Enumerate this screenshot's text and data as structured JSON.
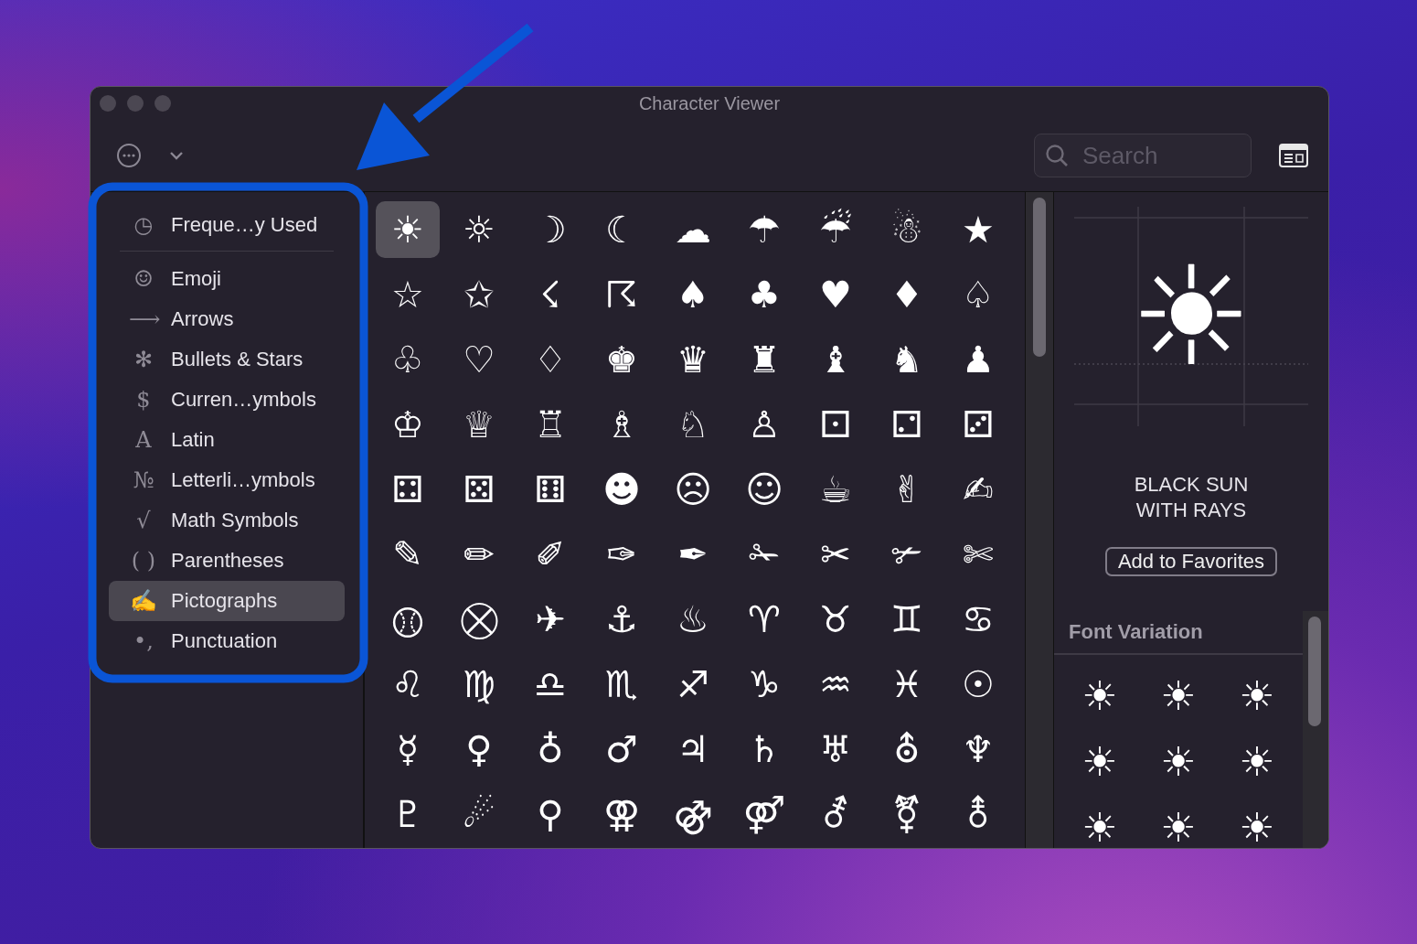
{
  "window": {
    "title": "Character Viewer"
  },
  "search": {
    "placeholder": "Search"
  },
  "sidebar": {
    "items": [
      {
        "icon": "◷",
        "label": "Freque…y Used",
        "selected": false
      },
      {
        "icon": "☺",
        "label": "Emoji",
        "selected": false
      },
      {
        "icon": "⟶",
        "label": "Arrows",
        "selected": false
      },
      {
        "icon": "✻",
        "label": "Bullets & Stars",
        "selected": false
      },
      {
        "icon": "$",
        "label": "Curren…ymbols",
        "selected": false
      },
      {
        "icon": "A",
        "label": "Latin",
        "selected": false
      },
      {
        "icon": "№",
        "label": "Letterli…ymbols",
        "selected": false
      },
      {
        "icon": "√",
        "label": "Math Symbols",
        "selected": false
      },
      {
        "icon": "( )",
        "label": "Parentheses",
        "selected": false
      },
      {
        "icon": "✍",
        "label": "Pictographs",
        "selected": true
      },
      {
        "icon": "•,",
        "label": "Punctuation",
        "selected": false
      }
    ]
  },
  "characters": [
    [
      {
        "char": "☀",
        "selected": true
      },
      {
        "char": "☼",
        "selected": false
      },
      {
        "char": "☽",
        "selected": false
      },
      {
        "char": "☾",
        "selected": false
      },
      {
        "char": "☁",
        "selected": false
      },
      {
        "char": "☂",
        "selected": false
      },
      {
        "char": "☔",
        "selected": false
      },
      {
        "char": "☃",
        "selected": false
      },
      {
        "char": "★",
        "selected": false
      }
    ],
    [
      {
        "char": "☆",
        "selected": false
      },
      {
        "char": "✩",
        "selected": false
      },
      {
        "char": "☇",
        "selected": false
      },
      {
        "char": "☈",
        "selected": false
      },
      {
        "char": "♠",
        "selected": false
      },
      {
        "char": "♣",
        "selected": false
      },
      {
        "char": "♥",
        "selected": false
      },
      {
        "char": "♦",
        "selected": false
      },
      {
        "char": "♤",
        "selected": false
      }
    ],
    [
      {
        "char": "♧",
        "selected": false
      },
      {
        "char": "♡",
        "selected": false
      },
      {
        "char": "♢",
        "selected": false
      },
      {
        "char": "♚",
        "selected": false
      },
      {
        "char": "♛",
        "selected": false
      },
      {
        "char": "♜",
        "selected": false
      },
      {
        "char": "♝",
        "selected": false
      },
      {
        "char": "♞",
        "selected": false
      },
      {
        "char": "♟",
        "selected": false
      }
    ],
    [
      {
        "char": "♔",
        "selected": false
      },
      {
        "char": "♕",
        "selected": false
      },
      {
        "char": "♖",
        "selected": false
      },
      {
        "char": "♗",
        "selected": false
      },
      {
        "char": "♘",
        "selected": false
      },
      {
        "char": "♙",
        "selected": false
      },
      {
        "char": "⚀",
        "selected": false
      },
      {
        "char": "⚁",
        "selected": false
      },
      {
        "char": "⚂",
        "selected": false
      }
    ],
    [
      {
        "char": "⚃",
        "selected": false
      },
      {
        "char": "⚄",
        "selected": false
      },
      {
        "char": "⚅",
        "selected": false
      },
      {
        "char": "☻",
        "selected": false
      },
      {
        "char": "☹",
        "selected": false
      },
      {
        "char": "☺",
        "selected": false
      },
      {
        "char": "☕",
        "selected": false
      },
      {
        "char": "✌",
        "selected": false
      },
      {
        "char": "✍",
        "selected": false
      }
    ],
    [
      {
        "char": "✎",
        "selected": false
      },
      {
        "char": "✏",
        "selected": false
      },
      {
        "char": "✐",
        "selected": false
      },
      {
        "char": "✑",
        "selected": false
      },
      {
        "char": "✒",
        "selected": false
      },
      {
        "char": "✁",
        "selected": false
      },
      {
        "char": "✂",
        "selected": false
      },
      {
        "char": "✃",
        "selected": false
      },
      {
        "char": "✄",
        "selected": false
      }
    ],
    [
      {
        "char": "⚾︎",
        "selected": false
      },
      {
        "char": "⛒",
        "selected": false
      },
      {
        "char": "✈",
        "selected": false
      },
      {
        "char": "⚓",
        "selected": false
      },
      {
        "char": "♨",
        "selected": false
      },
      {
        "char": "♈",
        "selected": false
      },
      {
        "char": "♉",
        "selected": false
      },
      {
        "char": "♊",
        "selected": false
      },
      {
        "char": "♋",
        "selected": false
      }
    ],
    [
      {
        "char": "♌",
        "selected": false
      },
      {
        "char": "♍",
        "selected": false
      },
      {
        "char": "♎",
        "selected": false
      },
      {
        "char": "♏",
        "selected": false
      },
      {
        "char": "♐",
        "selected": false
      },
      {
        "char": "♑",
        "selected": false
      },
      {
        "char": "♒",
        "selected": false
      },
      {
        "char": "♓",
        "selected": false
      },
      {
        "char": "☉",
        "selected": false
      }
    ],
    [
      {
        "char": "☿",
        "selected": false
      },
      {
        "char": "♀",
        "selected": false
      },
      {
        "char": "♁",
        "selected": false
      },
      {
        "char": "♂",
        "selected": false
      },
      {
        "char": "♃",
        "selected": false
      },
      {
        "char": "♄",
        "selected": false
      },
      {
        "char": "♅",
        "selected": false
      },
      {
        "char": "⛢",
        "selected": false
      },
      {
        "char": "♆",
        "selected": false
      }
    ],
    [
      {
        "char": "♇",
        "selected": false
      },
      {
        "char": "☄",
        "selected": false
      },
      {
        "char": "⚲",
        "selected": false
      },
      {
        "char": "⚢",
        "selected": false
      },
      {
        "char": "⚣",
        "selected": false
      },
      {
        "char": "⚤",
        "selected": false
      },
      {
        "char": "⚦",
        "selected": false
      },
      {
        "char": "⚧",
        "selected": false
      },
      {
        "char": "⚨",
        "selected": false
      }
    ]
  ],
  "detail": {
    "preview": "☀",
    "name": "BLACK SUN\nWITH RAYS",
    "favorite_button": "Add to Favorites"
  },
  "font_variation": {
    "title": "Font Variation",
    "items": [
      "☀",
      "☀",
      "☀",
      "☀",
      "☀",
      "☀",
      "☀",
      "☀",
      "☀"
    ]
  }
}
